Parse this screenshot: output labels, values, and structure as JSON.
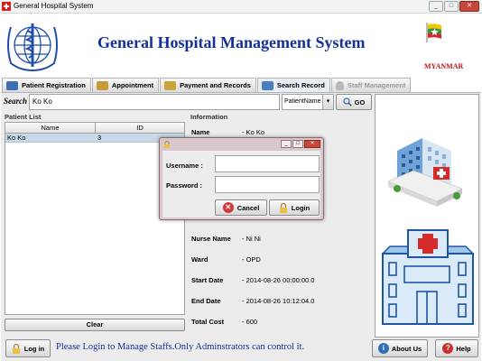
{
  "window": {
    "title": "General Hospital System",
    "min": "_",
    "max": "□",
    "close": "✕"
  },
  "header": {
    "app_title": "General Hospital Management System",
    "country": "MYANMAR"
  },
  "tabs": [
    {
      "label": "Patient Registration",
      "icon": "patient-icon",
      "color": "#3c6fb0"
    },
    {
      "label": "Appointment",
      "icon": "handshake-icon",
      "color": "#c49a3a"
    },
    {
      "label": "Payment and Records",
      "icon": "pen-icon",
      "color": "#caa43c"
    },
    {
      "label": "Search Record",
      "icon": "folder-icon",
      "color": "#4a7fc0"
    },
    {
      "label": "Staff Management",
      "icon": "user-icon",
      "color": "#b0b0b0"
    }
  ],
  "search": {
    "label": "Search",
    "value": "Ko Ko",
    "by": "PatientName",
    "dropdown_arrow": "▾",
    "go_label": "GO"
  },
  "patient_list": {
    "label": "Patient List",
    "columns": [
      "Name",
      "ID"
    ],
    "rows": [
      [
        "Ko Ko",
        "3"
      ]
    ],
    "clear_label": "Clear"
  },
  "information": {
    "label": "Information",
    "fields": [
      {
        "key": "Name",
        "value": "- Ko Ko"
      },
      {
        "key": "Nurse Name",
        "value": "- Ni Ni"
      },
      {
        "key": "Ward",
        "value": "- OPD"
      },
      {
        "key": "Start Date",
        "value": "- 2014-08-26 00:00:00.0"
      },
      {
        "key": "End Date",
        "value": "- 2014-08-26 10:12:04.0"
      },
      {
        "key": "Total Cost",
        "value": "- 600"
      }
    ]
  },
  "login_dialog": {
    "username_label": "Username :",
    "password_label": "Password :",
    "username_value": "",
    "password_value": "",
    "cancel_label": "Cancel",
    "login_label": "Login",
    "min": "_",
    "max": "□",
    "close": "✕"
  },
  "footer": {
    "login_label": "Log in",
    "message": "Please Login to Manage Staffs.Only Adminstrators can control it.",
    "about_label": "About Us",
    "help_label": "Help",
    "about_icon_glyph": "i",
    "help_icon_glyph": "?"
  },
  "colors": {
    "accent_blue": "#15309a",
    "country_red": "#c0161a"
  }
}
